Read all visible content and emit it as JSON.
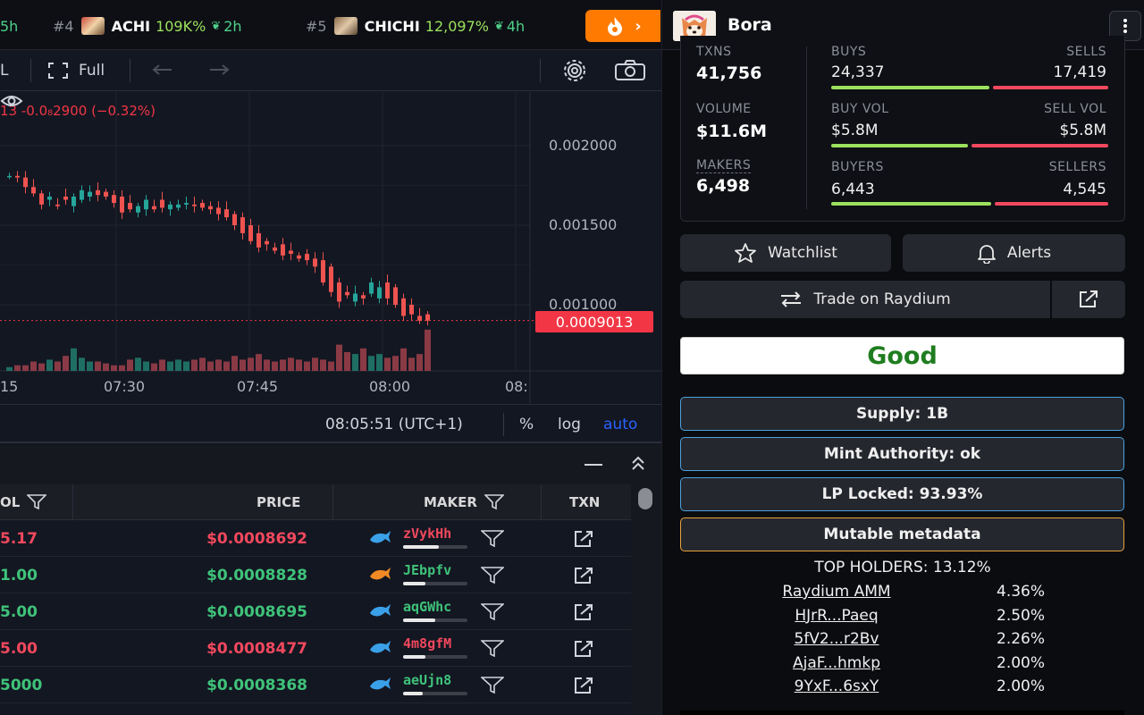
{
  "ticker": [
    {
      "rank": "",
      "name": "",
      "pct": "",
      "age": "5h"
    },
    {
      "rank": "#4",
      "name": "ACHI",
      "pct": "109K%",
      "age": "2h"
    },
    {
      "rank": "#5",
      "name": "CHICHI",
      "pct": "12,097%",
      "age": "4h"
    }
  ],
  "trending_button": {
    "icon": "fire-icon",
    "arrow": "›",
    "color": "#ff7a00"
  },
  "toolbar": {
    "left_text": "L",
    "full_label": "Full"
  },
  "chart": {
    "ohlc_text": "13  -0.0₈2900 (−0.32%)",
    "y_ticks": [
      "0.002000",
      "0.001500",
      "0.001000"
    ],
    "current_price": "0.0009013",
    "x_ticks": [
      "15",
      "07:30",
      "07:45",
      "08:00",
      "08:"
    ],
    "clock": "08:05:51 (UTC+1)",
    "scale_pct": "%",
    "scale_log": "log",
    "scale_auto": "auto"
  },
  "chart_data": {
    "type": "candlestick",
    "y_axis_ticks": [
      0.002,
      0.0015,
      0.001
    ],
    "last_price": 0.0009013,
    "x_axis_ticks": [
      "07:30",
      "07:45",
      "08:00"
    ],
    "open": [
      0.00181,
      0.00181,
      0.0018,
      0.00174,
      0.0017,
      0.00166,
      0.00163,
      0.00168,
      0.00162,
      0.00166,
      0.00168,
      0.00172,
      0.00171,
      0.00169,
      0.00168,
      0.00164,
      0.00158,
      0.0016,
      0.00162,
      0.00166,
      0.0016,
      0.00161,
      0.00163,
      0.00163,
      0.00164,
      0.00162,
      0.00161,
      0.0016,
      0.00157,
      0.00155,
      0.0015,
      0.00145,
      0.0014,
      0.00136,
      0.00138,
      0.00134,
      0.00131,
      0.00132,
      0.00129,
      0.00128,
      0.00124,
      0.00114,
      0.00108,
      0.00102,
      0.00106,
      0.00107,
      0.00104,
      0.00114,
      0.00111,
      0.00104,
      0.001,
      0.00093,
      0.00094
    ],
    "close": [
      0.00181,
      0.0018,
      0.00174,
      0.0017,
      0.00163,
      0.00168,
      0.00162,
      0.00166,
      0.00168,
      0.00172,
      0.00171,
      0.00169,
      0.00168,
      0.00164,
      0.00158,
      0.0016,
      0.00162,
      0.00166,
      0.0016,
      0.00161,
      0.00163,
      0.00163,
      0.00164,
      0.00162,
      0.00161,
      0.0016,
      0.00157,
      0.00155,
      0.0015,
      0.00145,
      0.0014,
      0.00136,
      0.00138,
      0.00134,
      0.00131,
      0.00132,
      0.00129,
      0.00128,
      0.00124,
      0.00114,
      0.00108,
      0.00102,
      0.00106,
      0.00107,
      0.00104,
      0.00114,
      0.00111,
      0.00104,
      0.001,
      0.00093,
      0.00094,
      0.0009,
      0.0009
    ],
    "volume": [
      2,
      3,
      3,
      5,
      4,
      6,
      5,
      8,
      12,
      7,
      5,
      5,
      4,
      3,
      3,
      6,
      7,
      5,
      4,
      6,
      5,
      6,
      5,
      6,
      7,
      5,
      6,
      5,
      8,
      6,
      7,
      9,
      6,
      5,
      6,
      7,
      6,
      5,
      7,
      6,
      5,
      14,
      10,
      9,
      12,
      8,
      9,
      7,
      8,
      12,
      7,
      9,
      22
    ]
  },
  "trades_panel": {
    "minimize": "—",
    "collapse": "⌃"
  },
  "trades_columns": {
    "vol": "OL",
    "price": "PRICE",
    "maker": "MAKER",
    "txn": "TXN"
  },
  "trades": [
    {
      "vol": "5.17",
      "price": "$0.0008692",
      "side": "sell",
      "maker": "zVykHh",
      "maker_icon": "whale-icon",
      "maker_share": 0.55
    },
    {
      "vol": "1.00",
      "price": "$0.0008828",
      "side": "buy",
      "maker": "JEbpfv",
      "maker_icon": "shrimp-icon",
      "maker_share": 0.35
    },
    {
      "vol": "5.00",
      "price": "$0.0008695",
      "side": "buy",
      "maker": "aqGWhc",
      "maker_icon": "dolphin-icon",
      "maker_share": 0.5
    },
    {
      "vol": "5.00",
      "price": "$0.0008477",
      "side": "sell",
      "maker": "4m8gfM",
      "maker_icon": "dolphin-icon",
      "maker_share": 0.35
    },
    {
      "vol": "5000",
      "price": "$0.0008368",
      "side": "buy",
      "maker": "aeUjn8",
      "maker_icon": "fish-icon",
      "maker_share": 0.3
    }
  ],
  "token": {
    "name": "Bora",
    "logo": "shiba-logo"
  },
  "stats": {
    "txns_label": "TXNS",
    "txns": "41,756",
    "volume_label": "VOLUME",
    "volume": "$11.6M",
    "makers_label": "MAKERS",
    "makers": "6,498",
    "buys_label": "BUYS",
    "buys": "24,337",
    "sells_label": "SELLS",
    "sells": "17,419",
    "buy_vol_label": "BUY VOL",
    "buy_vol": "$5.8M",
    "sell_vol_label": "SELL VOL",
    "sell_vol": "$5.8M",
    "buyers_label": "BUYERS",
    "buyers": "6,443",
    "sellers_label": "SELLERS",
    "sellers": "4,545",
    "buy_ratio": 0.58,
    "vol_ratio": 0.5,
    "buyer_ratio": 0.586,
    "buy_color": "#9be15d",
    "sell_color": "#f2485d"
  },
  "actions": {
    "watchlist": "Watchlist",
    "alerts": "Alerts",
    "trade": "Trade on Raydium"
  },
  "rating": {
    "label": "Good",
    "color": "#1f7d1f"
  },
  "checks": [
    {
      "label": "Supply: 1B",
      "status": "ok"
    },
    {
      "label": "Mint Authority: ok",
      "status": "ok"
    },
    {
      "label": "LP Locked: 93.93%",
      "status": "ok"
    },
    {
      "label": "Mutable metadata",
      "status": "warn"
    }
  ],
  "top_holders_title": "TOP HOLDERS: 13.12%",
  "holders": [
    {
      "name": "Raydium AMM",
      "pct": "4.36%"
    },
    {
      "name": "HJrR...Paeq",
      "pct": "2.50%"
    },
    {
      "name": "5fV2...r2Bv",
      "pct": "2.26%"
    },
    {
      "name": "AjaF...hmkp",
      "pct": "2.00%"
    },
    {
      "name": "9YxF...6sxY",
      "pct": "2.00%"
    }
  ]
}
